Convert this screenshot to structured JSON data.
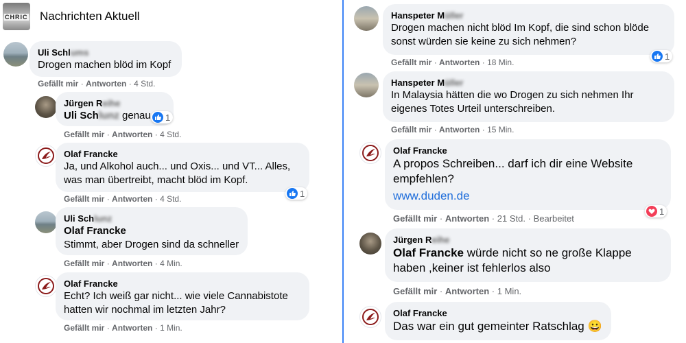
{
  "header": {
    "title": "Nachrichten Aktuell",
    "logo_text": "CHRIC"
  },
  "actions": {
    "like": "Gefällt mir",
    "reply": "Antworten",
    "sep": "·"
  },
  "left": [
    {
      "author_first": "Uli Schl",
      "author_blur": "ums",
      "text": "Drogen machen blöd im Kopf",
      "time": "4 Std."
    },
    {
      "author_first": "Jürgen R",
      "author_blur": "eihe",
      "tag_first": "Uli Sch",
      "tag_blur": "lunz",
      "text": " genau",
      "reaction_count": "1",
      "time": "4 Std."
    },
    {
      "author": "Olaf Francke",
      "text": "Ja, und Alkohol auch... und Oxis... und VT... Alles, was man übertreibt, macht blöd im Kopf.",
      "reaction_count": "1",
      "time": "4 Std."
    },
    {
      "author_first": "Uli Sch",
      "author_blur": "lunz",
      "tag": "Olaf Francke",
      "text": "Stimmt, aber Drogen sind da schneller",
      "time": "4 Min."
    },
    {
      "author": "Olaf Francke",
      "text": "Echt? Ich weiß gar nicht... wie viele Cannabistote hatten wir nochmal im letzten Jahr?",
      "time": "1 Min."
    }
  ],
  "right": [
    {
      "author_first": "Hanspeter M",
      "author_blur": "üller",
      "text": "Drogen machen nicht blöd Im Kopf, die sind schon blöde sonst würden sie keine zu sich nehmen?",
      "reaction_count": "1",
      "time": "18 Min."
    },
    {
      "author_first": "Hanspeter M",
      "author_blur": "üller",
      "text": "In Malaysia hätten die wo Drogen zu sich nehmen Ihr eigenes Totes Urteil unterschreiben.",
      "time": "15 Min."
    },
    {
      "author": "Olaf Francke",
      "text": "A propos Schreiben... darf ich dir eine Website empfehlen?",
      "link": "www.duden.de",
      "reaction_count": "1",
      "time": "21 Std.",
      "edited": "Bearbeitet"
    },
    {
      "author_first": "Jürgen R",
      "author_blur": "eihe",
      "tag": "Olaf Francke",
      "text": " würde nicht so ne große Klappe haben ,keiner ist fehlerlos also",
      "time": "1 Min."
    },
    {
      "author": "Olaf Francke",
      "text": "Das war ein gut gemeinter Ratschlag",
      "emoji": "😀"
    }
  ],
  "colors": {
    "bubble": "#f0f2f5",
    "meta": "#65676b",
    "like": "#1877f2",
    "love": "#f33e58",
    "link": "#216fdb",
    "divider": "#3b82f6"
  }
}
